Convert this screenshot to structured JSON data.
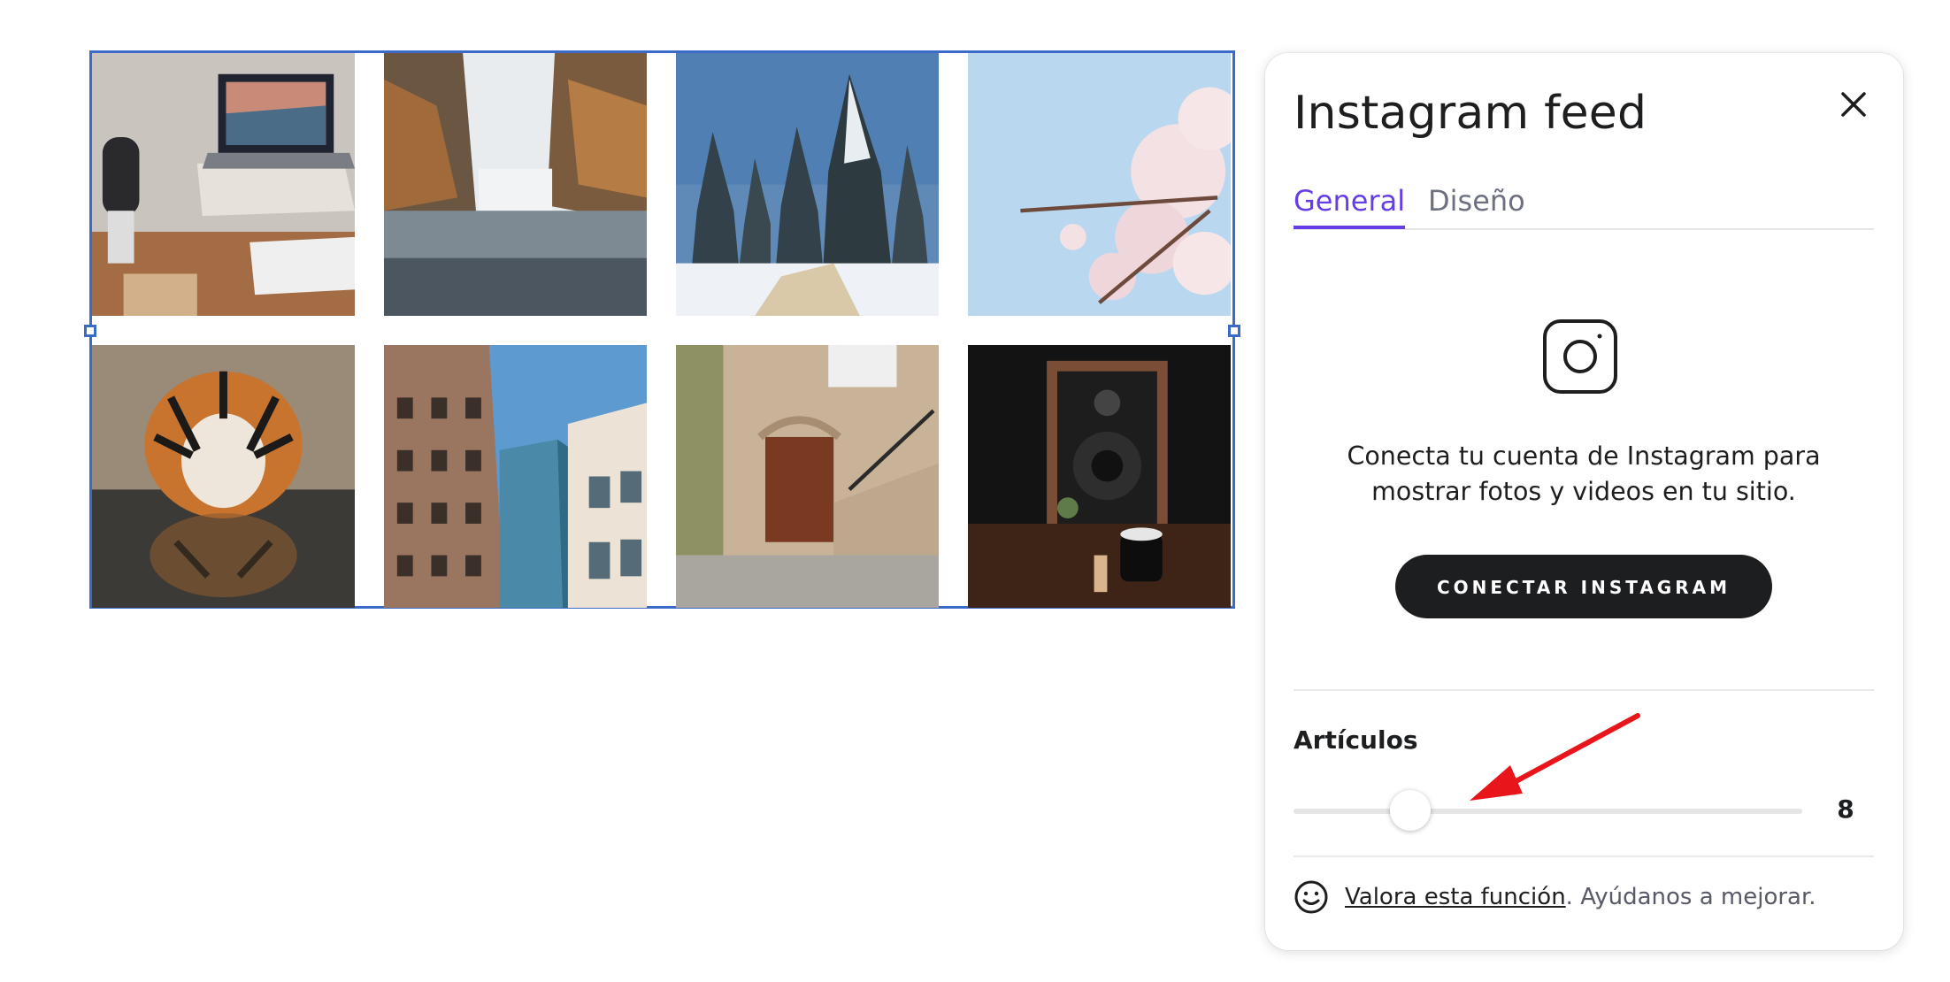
{
  "panel": {
    "title": "Instagram feed",
    "tabs": [
      {
        "label": "General",
        "active": true
      },
      {
        "label": "Diseño",
        "active": false
      }
    ],
    "connect_message": "Conecta tu cuenta de Instagram para mostrar fotos y videos en tu sitio.",
    "connect_button": "CONECTAR INSTAGRAM",
    "items_label": "Artículos",
    "items_value": "8",
    "slider_fraction": 0.23,
    "feedback_link": "Valora esta función",
    "feedback_rest": ". Ayúdanos a mejorar."
  },
  "feed": {
    "tiles": [
      {
        "subject": "desk-laptop-photo"
      },
      {
        "subject": "waterfall-photo"
      },
      {
        "subject": "snowy-trees-photo"
      },
      {
        "subject": "cherry-blossom-photo"
      },
      {
        "subject": "tiger-photo"
      },
      {
        "subject": "buildings-photo"
      },
      {
        "subject": "stone-house-door-photo"
      },
      {
        "subject": "speaker-photo"
      }
    ]
  },
  "colors": {
    "accent": "#673de6",
    "selection": "#3a6bc9",
    "button_bg": "#1d1e20",
    "annotation_arrow": "#e8151b"
  },
  "icons": [
    "close-icon",
    "instagram-icon",
    "smile-icon"
  ]
}
